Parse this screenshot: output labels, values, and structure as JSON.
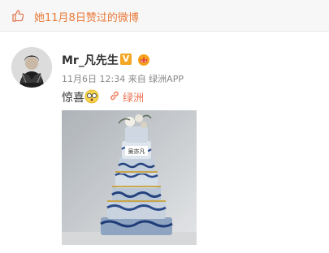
{
  "header": {
    "like_icon": "thumbs-up-outline-icon",
    "liked_text": "她11月8日赞过的微博"
  },
  "post": {
    "author": "Mr_凡先生",
    "verified_badge": "V",
    "member_badge_icon": "crown-member-icon",
    "meta": "11月6日 12:34 来自 绿洲APP",
    "text": "惊喜",
    "emoji_icon": "surprised-glasses-emoji-icon",
    "link_icon": "link-icon",
    "link_text": "绿洲",
    "image_description_icon": "tiered-cake-photo",
    "cake_topper_text": "吴亦凡"
  },
  "colors": {
    "orange_accent": "#ea7a3a",
    "verified": "#f5a623",
    "link": "#eb7350"
  }
}
